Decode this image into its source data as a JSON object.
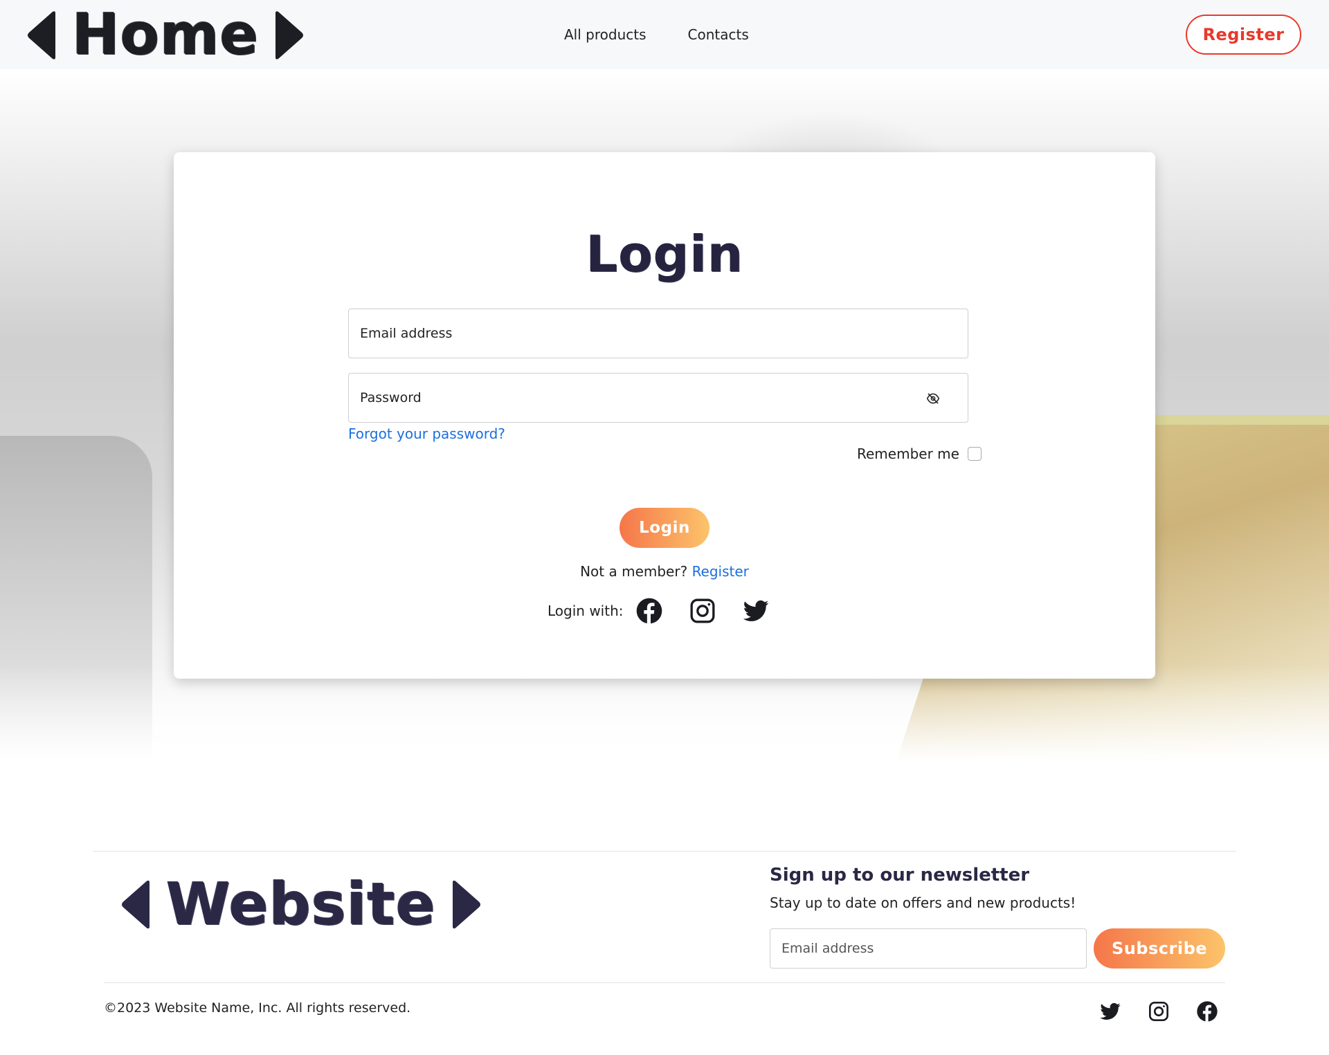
{
  "header": {
    "logo_text": "Home",
    "nav": [
      {
        "label": "All products"
      },
      {
        "label": "Contacts"
      }
    ],
    "register_label": "Register"
  },
  "login": {
    "title": "Login",
    "email_placeholder": "Email address",
    "password_placeholder": "Password",
    "forgot_label": "Forgot your password?",
    "remember_label": "Remember me",
    "submit_label": "Login",
    "not_member_text": "Not a member?",
    "register_link": "Register",
    "login_with_label": "Login with:",
    "social_icons": [
      "facebook-icon",
      "instagram-icon",
      "twitter-icon"
    ]
  },
  "footer": {
    "logo_text": "Website",
    "newsletter_title": "Sign up to our newsletter",
    "newsletter_subtitle": "Stay up to date on offers and new products!",
    "email_placeholder": "Email address",
    "subscribe_label": "Subscribe",
    "copyright": "©2023 Website Name, Inc. All rights reserved.",
    "social_icons": [
      "twitter-icon",
      "instagram-icon",
      "facebook-icon"
    ]
  },
  "colors": {
    "accent_red": "#e8392b",
    "gradient_start": "#f5764a",
    "gradient_end": "#fcc46a",
    "link_blue": "#1a6fe0",
    "dark_navy": "#25233f"
  }
}
